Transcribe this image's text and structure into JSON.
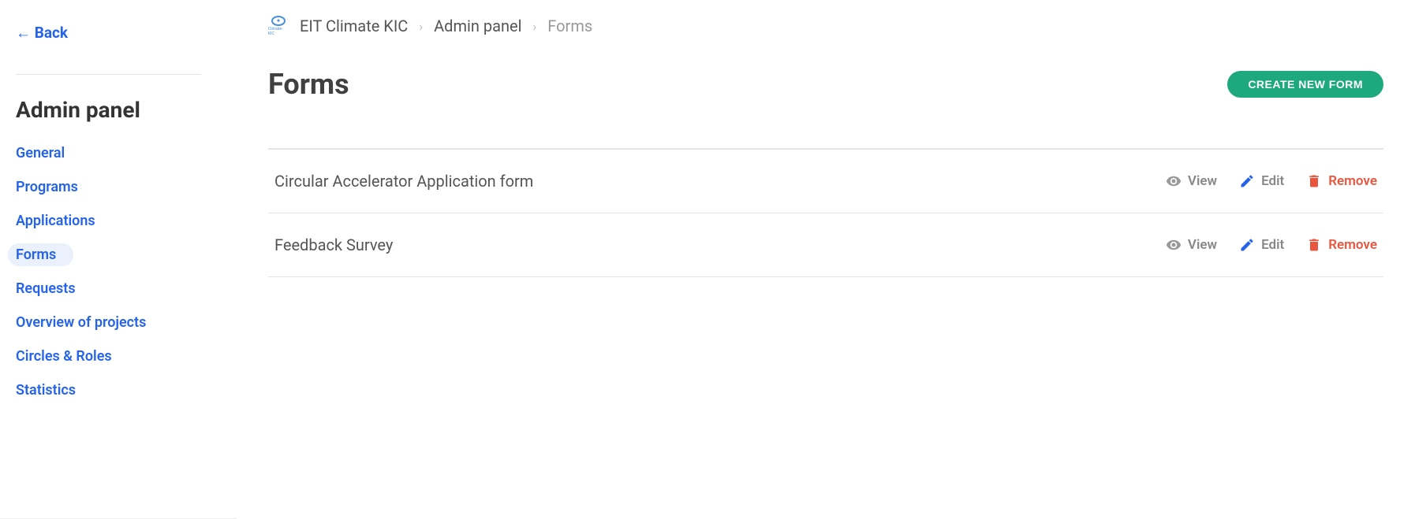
{
  "sidebar": {
    "back_label": "← Back",
    "title": "Admin panel",
    "items": [
      {
        "label": "General",
        "active": false
      },
      {
        "label": "Programs",
        "active": false
      },
      {
        "label": "Applications",
        "active": false
      },
      {
        "label": "Forms",
        "active": true
      },
      {
        "label": "Requests",
        "active": false
      },
      {
        "label": "Overview of projects",
        "active": false
      },
      {
        "label": "Circles & Roles",
        "active": false
      },
      {
        "label": "Statistics",
        "active": false
      }
    ]
  },
  "breadcrumb": {
    "org": "EIT Climate KIC",
    "panel": "Admin panel",
    "current": "Forms",
    "logo_text": "Climate-KIC"
  },
  "page": {
    "title": "Forms",
    "create_button": "CREATE NEW FORM"
  },
  "forms": [
    {
      "name": "Circular Accelerator Application form"
    },
    {
      "name": "Feedback Survey"
    }
  ],
  "actions": {
    "view": "View",
    "edit": "Edit",
    "remove": "Remove"
  }
}
